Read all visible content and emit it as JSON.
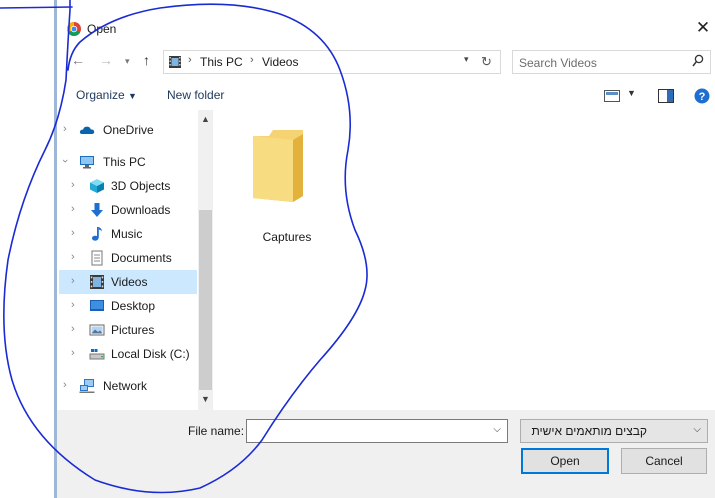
{
  "window": {
    "title": "Open"
  },
  "address": {
    "crumbs": [
      "This PC",
      "Videos"
    ]
  },
  "search": {
    "placeholder": "Search Videos"
  },
  "toolbar": {
    "organize_label": "Organize",
    "new_folder_label": "New folder"
  },
  "sidebar": {
    "items": [
      {
        "label": "OneDrive",
        "icon": "onedrive-icon"
      },
      {
        "label": "This PC",
        "icon": "computer-icon"
      },
      {
        "label": "3D Objects",
        "icon": "3d-objects-icon"
      },
      {
        "label": "Downloads",
        "icon": "downloads-icon"
      },
      {
        "label": "Music",
        "icon": "music-icon"
      },
      {
        "label": "Documents",
        "icon": "documents-icon"
      },
      {
        "label": "Videos",
        "icon": "videos-icon",
        "selected": true
      },
      {
        "label": "Desktop",
        "icon": "desktop-icon"
      },
      {
        "label": "Pictures",
        "icon": "pictures-icon"
      },
      {
        "label": "Local Disk (C:)",
        "icon": "disk-icon"
      },
      {
        "label": "Network",
        "icon": "network-icon"
      }
    ]
  },
  "content": {
    "items": [
      {
        "label": "Captures",
        "icon": "folder-icon"
      }
    ]
  },
  "bottom": {
    "file_name_label": "File name:",
    "file_name_value": "",
    "filter_value": "קבצים מותאמים אישית",
    "open_label": "Open",
    "cancel_label": "Cancel"
  },
  "colors": {
    "selection": "#cce8ff",
    "accent": "#0078d7",
    "annotation": "#1a2bd4"
  }
}
